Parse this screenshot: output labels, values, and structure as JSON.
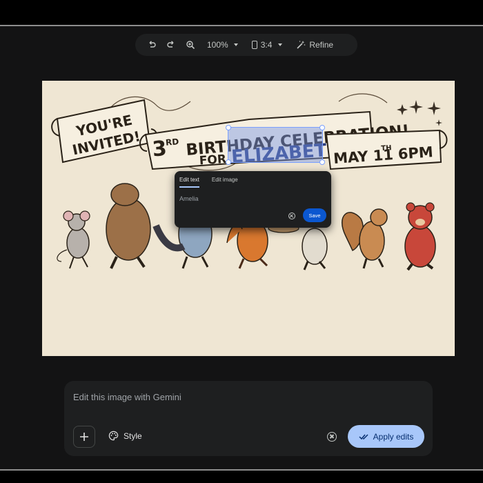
{
  "toolbar": {
    "undo_icon": "undo-icon",
    "redo_icon": "redo-icon",
    "zoom_icon": "zoom-in-icon",
    "zoom_level": "100%",
    "aspect_ratio": "3:4",
    "refine_label": "Refine"
  },
  "invitation": {
    "line1": "YOU'RE",
    "line2": "INVITED!",
    "number": "3",
    "ordinal": "RD",
    "celebration": "BIRTHDAY CELEBRATION!",
    "for_word": "FOR",
    "name": "ELIZABETH",
    "date_month_day": "MAY 11",
    "date_suffix": "TH",
    "time": "6PM"
  },
  "popover": {
    "tab_edit_text": "Edit text",
    "tab_edit_image": "Edit image",
    "input_value": "Amelia",
    "save_label": "Save"
  },
  "prompt": {
    "placeholder": "Edit this image with Gemini",
    "style_label": "Style",
    "apply_label": "Apply edits"
  },
  "colors": {
    "accent": "#a8c7fa",
    "save_button": "#0b57d0",
    "panel": "#1e1f20",
    "selection": "#7aa0ff"
  }
}
